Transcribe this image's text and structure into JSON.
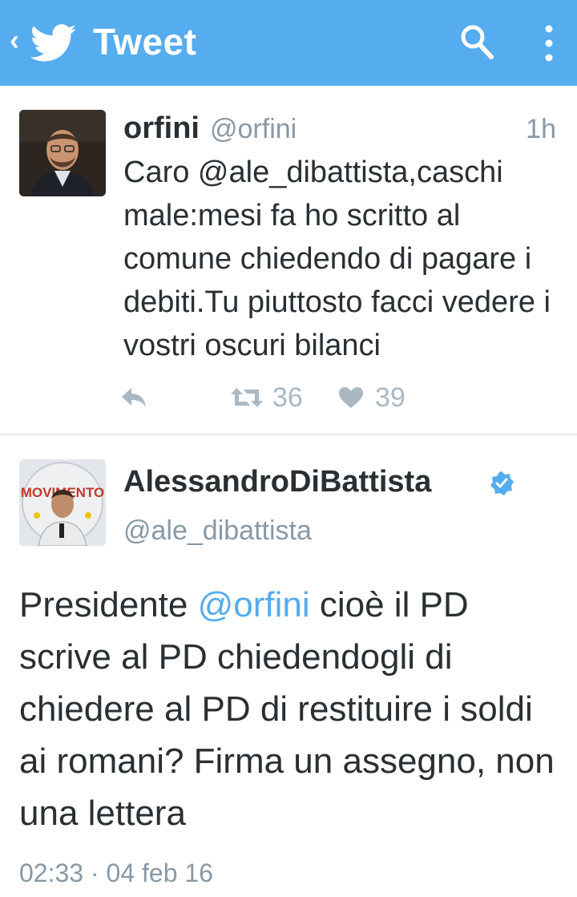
{
  "colors": {
    "accent": "#55acee",
    "text": "#292f33",
    "muted": "#8899a6",
    "action": "#aab8c2"
  },
  "header": {
    "back_glyph": "‹",
    "title": "Tweet",
    "icons": [
      "twitter-bird-icon",
      "search-icon",
      "overflow-menu-icon"
    ]
  },
  "tweet1": {
    "name": "orfini",
    "handle": "@orfini",
    "time": "1h",
    "text": "Caro @ale_dibattista,caschi male:mesi fa ho scritto al comune chiedendo di pagare i debiti.Tu piuttosto facci vedere i vostri oscuri bilanci",
    "retweets": "36",
    "likes": "39"
  },
  "tweet2": {
    "name": "AlessandroDiBattista",
    "handle": "@ale_dibattista",
    "verified": true,
    "text_before": "Presidente ",
    "mention": "@orfini",
    "text_after": " cioè il PD scrive al PD chiedendogli di chiedere al PD di restituire i soldi ai romani? Firma un assegno, non una lettera",
    "timestamp": "02:33 · 04 feb 16",
    "avatar_banner": "MOVIMENTO"
  }
}
